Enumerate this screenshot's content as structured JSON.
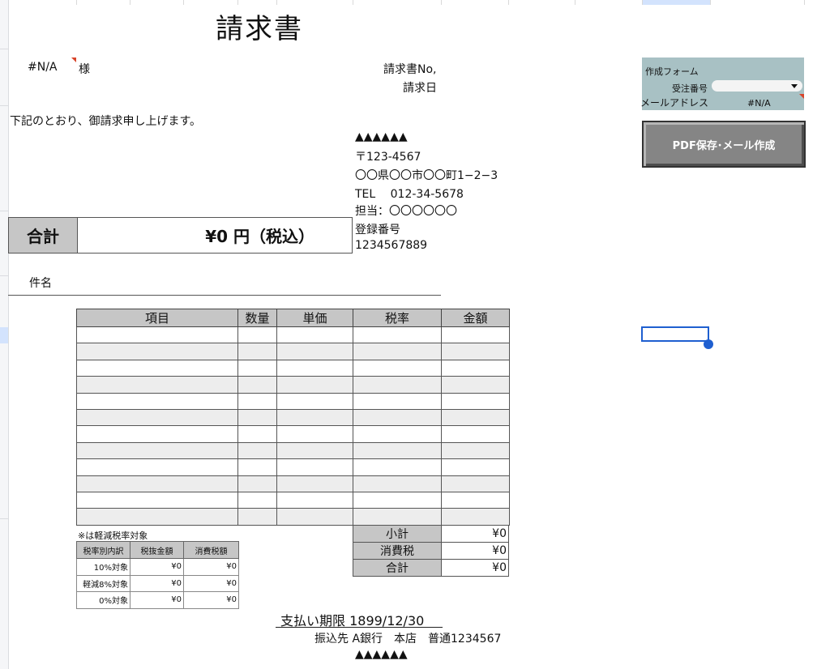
{
  "title": "請求書",
  "customer": {
    "name": "#N/A",
    "suffix": "様"
  },
  "invoice_meta": {
    "no_label": "請求書No,",
    "date_label": "請求日"
  },
  "greeting": "下記のとおり、御請求申し上げます。",
  "issuer": {
    "name": "▲▲▲▲▲▲",
    "postal": "〒123-4567",
    "address": "〇〇県〇〇市〇〇町1−2−3",
    "tel": "TEL　 012-34-5678",
    "contact": "担当：〇〇〇〇〇〇",
    "reg_label": "登録番号",
    "reg_number": "1234567889"
  },
  "total_box": {
    "label": "合計",
    "value": "¥0 円（税込）"
  },
  "subject_label": "件名",
  "items_table": {
    "headers": [
      "項目",
      "数量",
      "単価",
      "税率",
      "金額"
    ],
    "row_count": 12
  },
  "reduced_note": "※は軽減税率対象",
  "tax_breakdown": {
    "headers": [
      "税率別内訳",
      "税抜金額",
      "消費税額"
    ],
    "rows": [
      [
        "10%対象",
        "¥0",
        "¥0"
      ],
      [
        "軽減8%対象",
        "¥0",
        "¥0"
      ],
      [
        "0%対象",
        "¥0",
        "¥0"
      ]
    ]
  },
  "summary": [
    {
      "label": "小計",
      "value": "¥0"
    },
    {
      "label": "消費税",
      "value": "¥0"
    },
    {
      "label": "合計",
      "value": "¥0"
    }
  ],
  "payment": {
    "due": "支払い期限 1899/12/30",
    "bank": "振込先 A銀行　本店　普通1234567",
    "footer": "▲▲▲▲▲▲"
  },
  "form": {
    "title": "作成フォーム",
    "order_label": "受注番号",
    "order_value": "",
    "email_label": "メールアドレス",
    "email_value": "#N/A",
    "pdf_button": "PDF保存･メール作成"
  },
  "colors": {
    "header_gray": "#c6c6c6",
    "form_bg": "#a8c1c4",
    "selection": "#1f5fd0",
    "comment_marker": "#d8442a"
  }
}
